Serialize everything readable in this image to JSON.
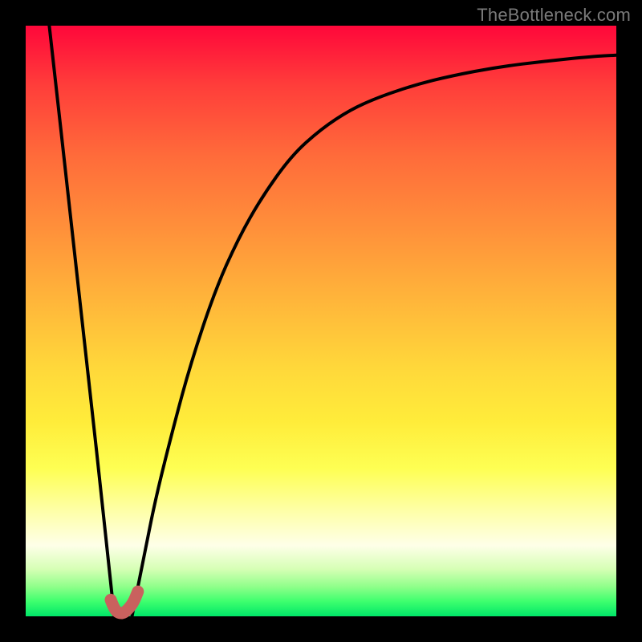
{
  "watermark": "TheBottleneck.com",
  "colors": {
    "frame": "#000000",
    "curve": "#000000",
    "marker": "#c9615e"
  },
  "chart_data": {
    "type": "line",
    "title": "",
    "xlabel": "",
    "ylabel": "",
    "xlim": [
      0,
      100
    ],
    "ylim": [
      0,
      100
    ],
    "grid": false,
    "series": [
      {
        "name": "left-branch",
        "x": [
          4,
          6,
          8,
          10,
          12,
          13.5,
          15
        ],
        "values": [
          100,
          82,
          64,
          46,
          28,
          14,
          0
        ]
      },
      {
        "name": "right-branch",
        "x": [
          18,
          20,
          22,
          25,
          28,
          32,
          36,
          40,
          45,
          50,
          55,
          60,
          66,
          72,
          80,
          88,
          96,
          100
        ],
        "values": [
          0,
          10,
          20,
          32,
          43,
          55,
          64,
          71,
          78,
          82.5,
          85.8,
          88,
          90,
          91.5,
          93,
          94,
          94.8,
          95
        ]
      }
    ],
    "marker": {
      "name": "optimal-point",
      "path_x": [
        14.4,
        15.0,
        15.8,
        16.8,
        18.2,
        19.0
      ],
      "path_y": [
        2.8,
        1.2,
        0.5,
        0.6,
        2.2,
        4.2
      ],
      "approx_x": 16.5,
      "approx_y": 0.5
    },
    "note": "Values are read off the rendered pixels; axes are unlabeled so x/y are expressed as 0–100 percent of the plot area."
  }
}
